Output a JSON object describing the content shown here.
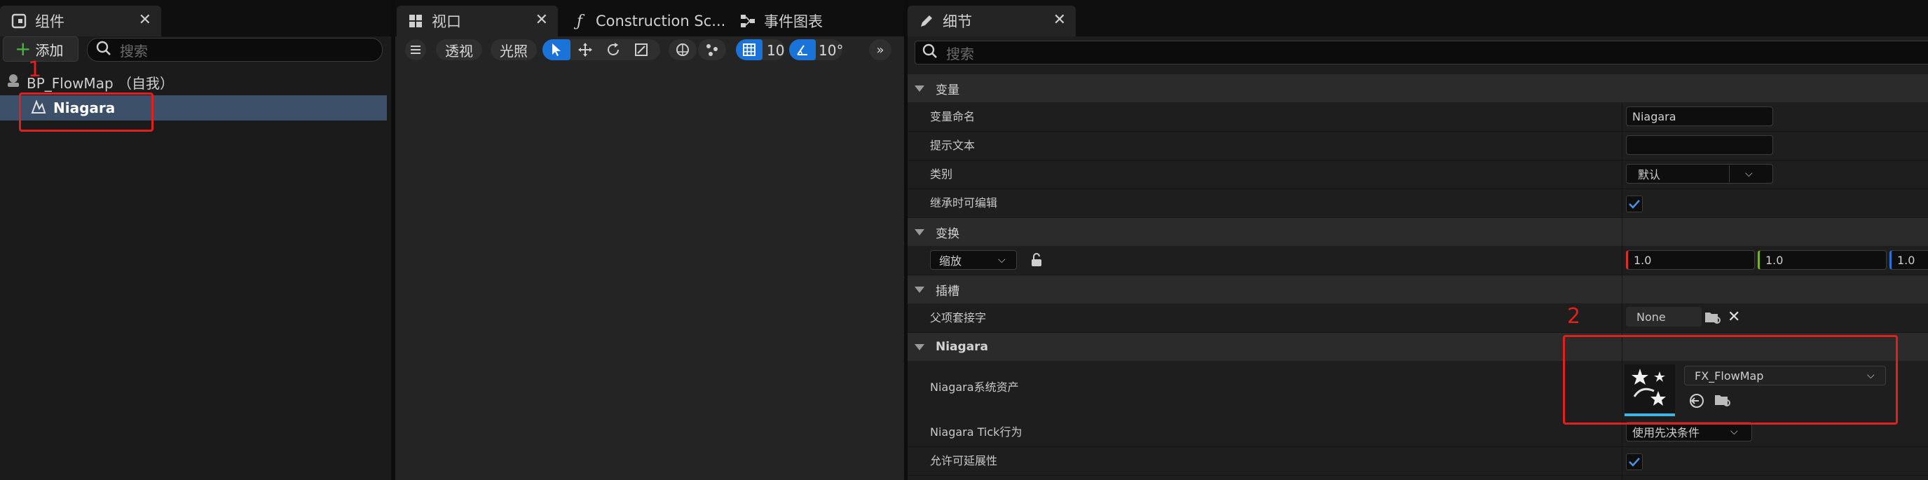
{
  "components_panel": {
    "tab_label": "组件",
    "add_button": "添加",
    "search_placeholder": "搜索",
    "tree": [
      {
        "label": "BP_FlowMap （自我）"
      },
      {
        "label": "Niagara"
      }
    ]
  },
  "viewport_tabs": {
    "viewport": "视口",
    "construction": "Construction Sc...",
    "event_graph": "事件图表"
  },
  "viewport_toolbar": {
    "perspective": "透视",
    "lighting": "光照",
    "grid_snap": "10",
    "rotation_snap": "10°"
  },
  "details_panel": {
    "tab_label": "细节",
    "search_placeholder": "搜索",
    "sections": {
      "variables": "变量",
      "transform": "变换",
      "sockets": "插槽",
      "niagara": "Niagara"
    },
    "props": {
      "var_name_label": "变量命名",
      "var_name_value": "Niagara",
      "tooltip_label": "提示文本",
      "tooltip_value": "",
      "category_label": "类别",
      "category_value": "默认",
      "editable_label": "继承时可编辑",
      "editable_checked": true,
      "scale_label": "缩放",
      "scale_x": "1.0",
      "scale_y": "1.0",
      "scale_z": "1.0",
      "parent_socket_label": "父项套接字",
      "parent_socket_value": "None",
      "niagara_asset_label": "Niagara系统资产",
      "niagara_asset_value": "FX_FlowMap",
      "niagara_tick_label": "Niagara Tick行为",
      "niagara_tick_value": "使用先决条件",
      "allow_scalability_label": "允许可延展性",
      "allow_scalability_checked": true
    }
  },
  "annotations": {
    "label_1": "1",
    "label_2": "2",
    "color": "#e0201c"
  },
  "colors": {
    "accent_blue": "#1a73d9",
    "panel_bg": "#1a1a1a",
    "selected_row": "#3d5069"
  }
}
